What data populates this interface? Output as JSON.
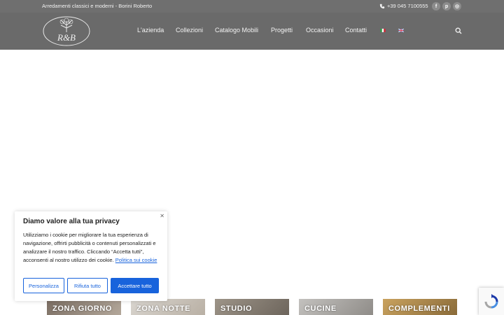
{
  "topbar": {
    "tagline": "Arredamenti classici e moderni - Borini Roberto",
    "phone": "+39 045 7100555",
    "social": [
      {
        "name": "facebook-icon",
        "glyph": "f"
      },
      {
        "name": "pinterest-icon",
        "glyph": "p"
      },
      {
        "name": "instagram-icon",
        "glyph": "◎"
      }
    ]
  },
  "header": {
    "logo_text": "R&B",
    "nav": [
      "L'azienda",
      "Collezioni",
      "Catalogo Mobili",
      "Progetti",
      "Occasioni",
      "Contatti"
    ],
    "languages": [
      "it",
      "en"
    ]
  },
  "categories": [
    "ZONA GIORNO",
    "ZONA NOTTE",
    "STUDIO",
    "CUCINE",
    "COMPLEMENTI"
  ],
  "cookie": {
    "title": "Diamo valore alla tua privacy",
    "text": "Utilizziamo i cookie per migliorare la tua esperienza di navigazione, offrirti pubblicità o contenuti personalizzati e analizzare il nostro traffico. Cliccando “Accetta tutti”, acconsenti al nostro utilizzo dei cookie.",
    "link": "Politica sui cookie",
    "buttons": {
      "customize": "Personalizza",
      "reject": "Rifiuta tutto",
      "accept": "Accettare tutto"
    }
  },
  "colors": {
    "header_bg": "#6a6a6a",
    "topbar_bg": "#6f6f6f",
    "accent": "#1863dc"
  }
}
